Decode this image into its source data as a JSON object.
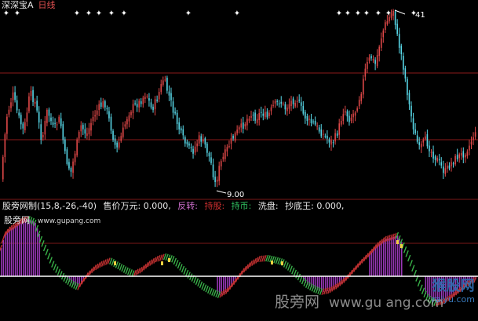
{
  "window": {
    "stock_code": "深深宝A",
    "period": "日线"
  },
  "price_chart": {
    "high_label": "41",
    "low_label": "9.00",
    "diamond_markers": 16
  },
  "indicator": {
    "name_params": "股旁网制(15,8,-26,-40)",
    "items": [
      {
        "label": "售价万元:",
        "value": "0.000,",
        "color": "#e8e8e8"
      },
      {
        "label": "反转:",
        "value": "",
        "color": "#d070d0"
      },
      {
        "label": "持股:",
        "value": "",
        "color": "#d03030"
      },
      {
        "label": "持币:",
        "value": "",
        "color": "#30c060"
      },
      {
        "label": "洗盘:",
        "value": "",
        "color": "#e8e8e8"
      },
      {
        "label": "抄底王:",
        "value": "0.000,",
        "color": "#e8e8e8"
      }
    ]
  },
  "watermarks": {
    "indicator_brand": "股旁网",
    "indicator_site": "www.gupang.com",
    "bottom_brand": "股旁网",
    "bottom_url": "www.gu ang.com",
    "corner_cn": "猴股网",
    "corner_en": "raiyu.com"
  },
  "colors": {
    "up": "#e04848",
    "down": "#58d8e8",
    "grid": "#8b1a1a",
    "bar_purple": "#9a38b8",
    "bar_red": "#c03030",
    "bar_green": "#38b048",
    "bar_yellow": "#f0d040",
    "baseline": "#ffffff"
  }
}
